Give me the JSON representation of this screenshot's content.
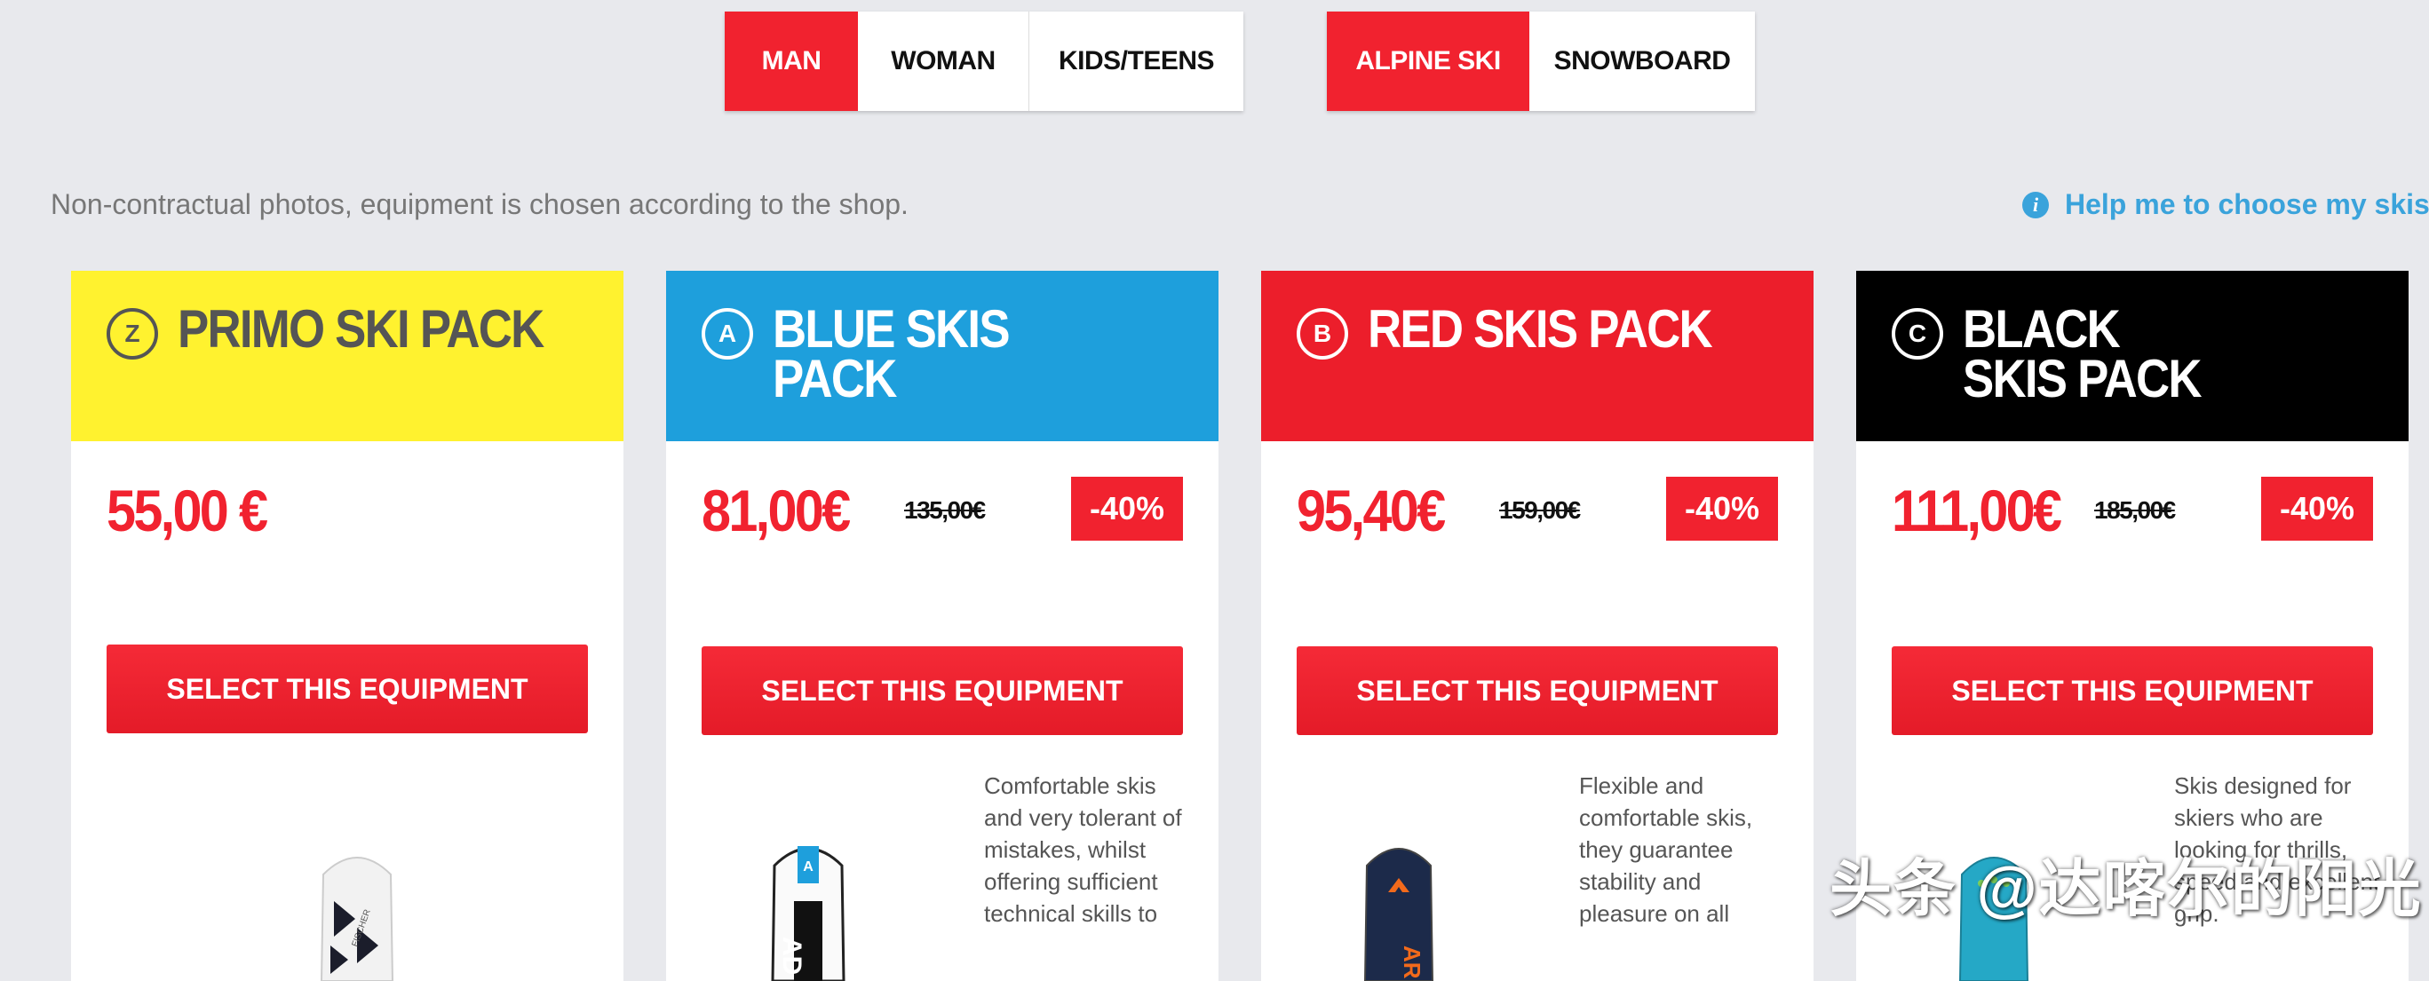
{
  "gender_tabs": [
    {
      "label": "MAN",
      "active": true
    },
    {
      "label": "WOMAN",
      "active": false
    },
    {
      "label": "KIDS/TEENS",
      "active": false
    }
  ],
  "sport_tabs": [
    {
      "label": "ALPINE SKI",
      "active": true
    },
    {
      "label": "SNOWBOARD",
      "active": false
    }
  ],
  "disclaimer": "Non-contractual photos, equipment is chosen according to the shop.",
  "help_link": "Help me to choose my skis",
  "help_icon": "info-icon",
  "colors": {
    "accent": "#f1222f",
    "link": "#3aa3db",
    "yellow": "#fff22f",
    "blue": "#1e9fdc",
    "red": "#ec1e2b",
    "black": "#000000"
  },
  "cards": [
    {
      "badge": "Z",
      "title": "PRIMO SKI PACK",
      "price": "55,00 €",
      "old_price": "",
      "discount": "",
      "button": "SELECT THIS EQUIPMENT",
      "description": ""
    },
    {
      "badge": "A",
      "title": "BLUE SKIS PACK",
      "price": "81,00€",
      "old_price": "135,00€",
      "discount": "-40%",
      "button": "SELECT THIS EQUIPMENT",
      "description": "Comfortable skis and very tolerant of mistakes, whilst offering sufficient technical skills to"
    },
    {
      "badge": "B",
      "title": "RED SKIS PACK",
      "price": "95,40€",
      "old_price": "159,00€",
      "discount": "-40%",
      "button": "SELECT THIS EQUIPMENT",
      "description": "Flexible and comfortable skis, they guarantee stability and pleasure on all"
    },
    {
      "badge": "C",
      "title": "BLACK SKIS PACK",
      "price": "111,00€",
      "old_price": "185,00€",
      "discount": "-40%",
      "button": "SELECT THIS EQUIPMENT",
      "description": "Skis designed for skiers who are looking for thrills, speed and excellent grip."
    }
  ],
  "watermark": "头条 @达喀尔的阳光"
}
